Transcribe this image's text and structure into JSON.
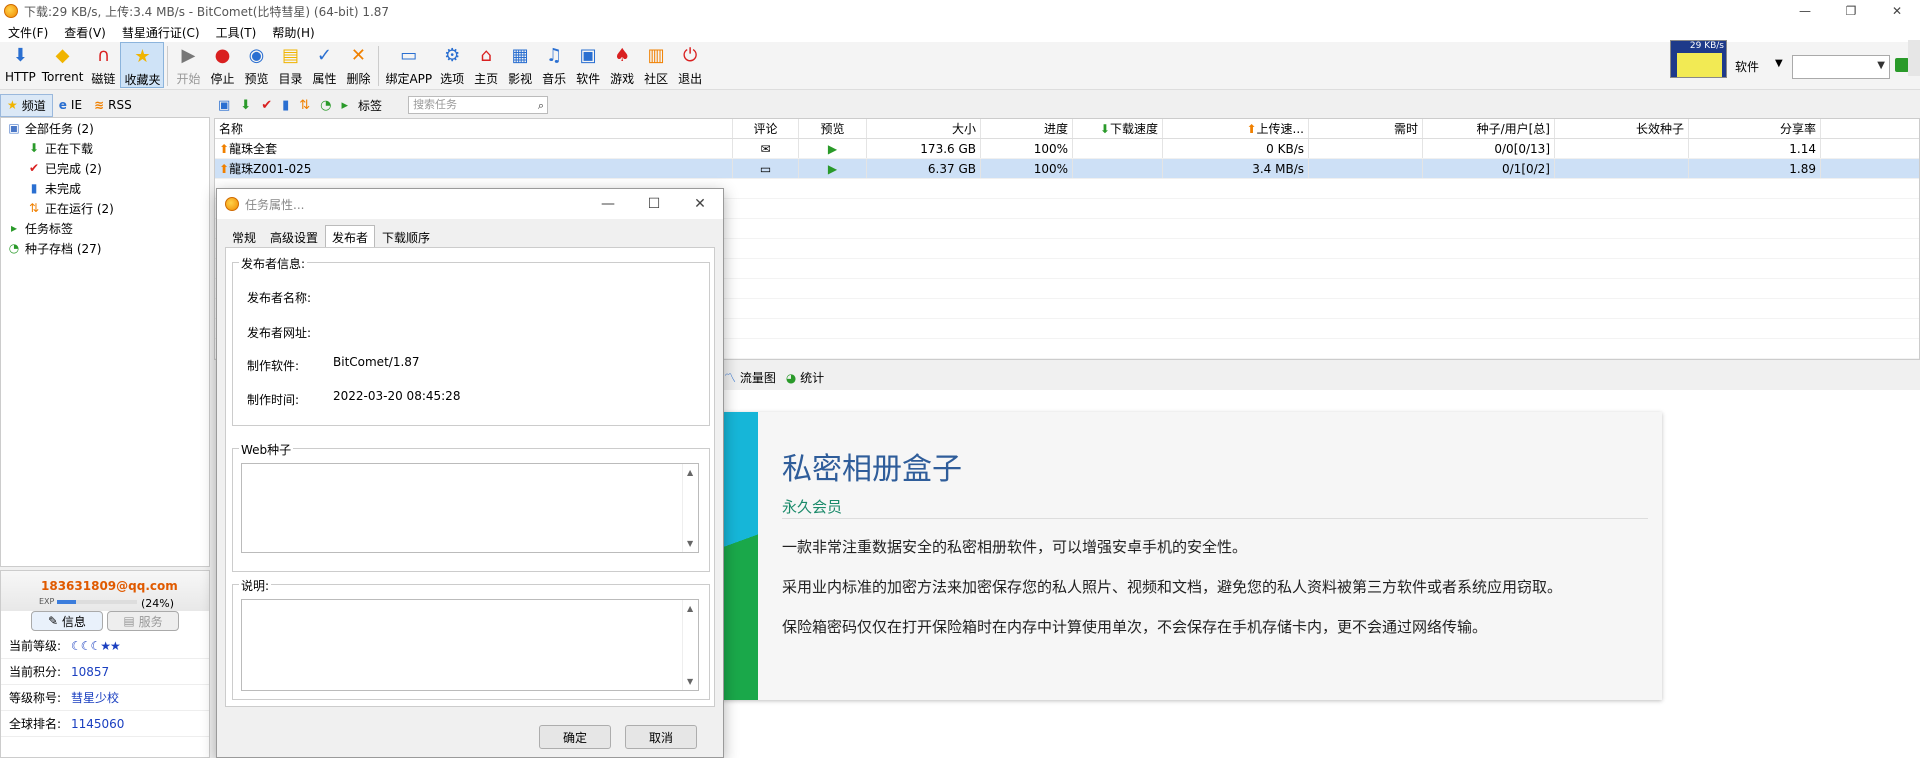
{
  "window": {
    "title": "下载:29 KB/s, 上传:3.4 MB/s - BitComet(比特彗星) (64-bit) 1.87",
    "min": "—",
    "max": "❐",
    "close": "✕"
  },
  "menu": [
    "文件(F)",
    "查看(V)",
    "彗星通行证(C)",
    "工具(T)",
    "帮助(H)"
  ],
  "toolbar": {
    "items": [
      {
        "label": "HTTP",
        "icon": "⬇",
        "name": "http-button",
        "color": "blue"
      },
      {
        "label": "Torrent",
        "icon": "◆",
        "name": "torrent-button",
        "color": "yellow"
      },
      {
        "label": "磁链",
        "icon": "∩",
        "name": "magnet-button",
        "color": "red"
      },
      {
        "label": "收藏夹",
        "icon": "★",
        "name": "favorites-button",
        "color": "yellow",
        "active": true
      },
      {
        "label": "开始",
        "icon": "▶",
        "name": "start-button",
        "color": "gray",
        "disabled": true
      },
      {
        "label": "停止",
        "icon": "●",
        "name": "stop-button",
        "color": "red"
      },
      {
        "label": "预览",
        "icon": "◉",
        "name": "preview-button",
        "color": "blue"
      },
      {
        "label": "目录",
        "icon": "▤",
        "name": "directory-button",
        "color": "yellow"
      },
      {
        "label": "属性",
        "icon": "✓",
        "name": "properties-button",
        "color": "blue"
      },
      {
        "label": "删除",
        "icon": "✕",
        "name": "delete-button",
        "color": "orange"
      },
      {
        "label": "绑定APP",
        "icon": "▭",
        "name": "bind-app-button",
        "color": "blue"
      },
      {
        "label": "选项",
        "icon": "⚙",
        "name": "options-button",
        "color": "blue"
      },
      {
        "label": "主页",
        "icon": "⌂",
        "name": "home-button",
        "color": "red"
      },
      {
        "label": "影视",
        "icon": "▦",
        "name": "video-button",
        "color": "blue"
      },
      {
        "label": "音乐",
        "icon": "♫",
        "name": "music-button",
        "color": "blue"
      },
      {
        "label": "软件",
        "icon": "▣",
        "name": "software-button",
        "color": "blue"
      },
      {
        "label": "游戏",
        "icon": "♠",
        "name": "games-button",
        "color": "red"
      },
      {
        "label": "社区",
        "icon": "▥",
        "name": "community-button",
        "color": "orange"
      },
      {
        "label": "退出",
        "icon": "⏻",
        "name": "exit-button",
        "color": "red"
      }
    ],
    "graph_label": "29 KB/s",
    "soft_label": "软件",
    "dropdown_arrow": "▼"
  },
  "sidebar": {
    "tabs": [
      {
        "label": "频道",
        "icon": "★",
        "on": true
      },
      {
        "label": "IE",
        "icon": "e"
      },
      {
        "label": "RSS",
        "icon": "≋"
      }
    ],
    "tree": [
      {
        "label": "全部任务 (2)",
        "icon": "▣",
        "indent": 6,
        "color": "#4a78c8"
      },
      {
        "label": "正在下载",
        "icon": "⬇",
        "indent": 26,
        "color": "#2a9a2a"
      },
      {
        "label": "已完成 (2)",
        "icon": "✔",
        "indent": 26,
        "color": "#d92020"
      },
      {
        "label": "未完成",
        "icon": "▮",
        "indent": 26,
        "color": "#2a6fd1"
      },
      {
        "label": "正在运行 (2)",
        "icon": "⇅",
        "indent": 26,
        "color": "#f08000"
      },
      {
        "label": "任务标签",
        "icon": "▸",
        "indent": 6,
        "color": "#2a9a2a"
      },
      {
        "label": "种子存档 (27)",
        "icon": "◔",
        "indent": 6,
        "color": "#2a9a2a"
      }
    ]
  },
  "user": {
    "email": "183631809@qq.com",
    "exp_label": "EXP",
    "exp_pct": "(24%)",
    "exp_value": 0.24,
    "btn_info": "信息",
    "btn_service": "服务",
    "rows": [
      {
        "k": "当前等级:",
        "v": "☾☾☾★★",
        "stars": true
      },
      {
        "k": "当前积分:",
        "v": "10857"
      },
      {
        "k": "等级称号:",
        "v": "彗星少校"
      },
      {
        "k": "全球排名:",
        "v": "1145060"
      }
    ]
  },
  "listbar": {
    "tag_label": "标签",
    "search_placeholder": "搜索任务",
    "search_icon": "⌕"
  },
  "tasklist": {
    "columns": [
      "名称",
      "评论",
      "预览",
      "大小",
      "进度",
      "下载速度",
      "上传速...",
      "需时",
      "种子/用户[总]",
      "长效种子",
      "分享率"
    ],
    "rows": [
      {
        "name": "龍珠全套",
        "comment": "✉",
        "preview": "▶",
        "size": "173.6 GB",
        "progress": "100%",
        "down": "",
        "up": "0 KB/s",
        "eta": "",
        "peers": "0/0[0/13]",
        "long": "",
        "ratio": "1.14",
        "selected": false
      },
      {
        "name": "龍珠Z001-025",
        "comment": "▭",
        "preview": "▶",
        "size": "6.37 GB",
        "progress": "100%",
        "down": "",
        "up": "3.4 MB/s",
        "eta": "",
        "peers": "0/1[0/2]",
        "long": "",
        "ratio": "1.89",
        "selected": true
      }
    ]
  },
  "lowertabs": [
    {
      "label": "流量图",
      "icon": "〽"
    },
    {
      "label": "统计",
      "icon": "◕"
    }
  ],
  "ad": {
    "title": "私密相册盒子",
    "subtitle": "永久会员",
    "lines": [
      "一款非常注重数据安全的私密相册软件，可以增强安卓手机的安全性。",
      "采用业内标准的加密方法来加密保存您的私人照片、视频和文档，避免您的私人资料被第三方软件或者系统应用窃取。",
      "保险箱密码仅仅在打开保险箱时在内存中计算使用单次，不会保存在手机存储卡内，更不会通过网络传输。"
    ]
  },
  "dialog": {
    "title": "任务属性...",
    "min": "—",
    "max": "☐",
    "close": "✕",
    "tabs": [
      "常规",
      "高级设置",
      "发布者",
      "下载顺序"
    ],
    "active_tab": 2,
    "publisher_group": "发布者信息:",
    "fields": [
      {
        "label": "发布者名称:",
        "value": ""
      },
      {
        "label": "发布者网址:",
        "value": ""
      },
      {
        "label": "制作软件:",
        "value": "BitComet/1.87"
      },
      {
        "label": "制作时间:",
        "value": "2022-03-20 08:45:28"
      }
    ],
    "web_seed_group": "Web种子",
    "note_group": "说明:",
    "ok": "确定",
    "cancel": "取消"
  }
}
